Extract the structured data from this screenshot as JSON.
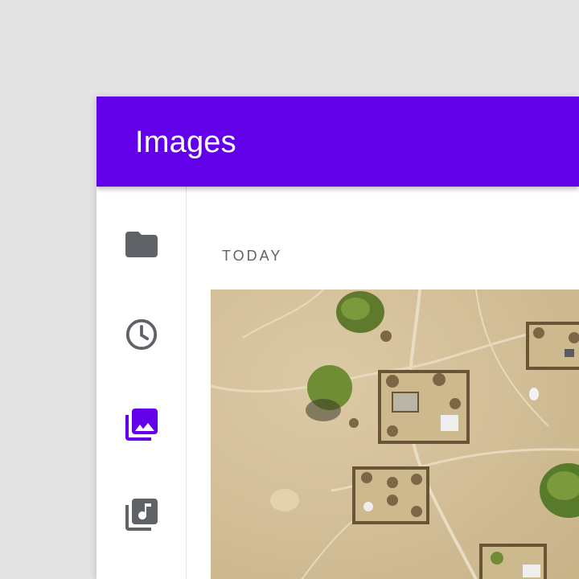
{
  "app": {
    "title": "Images"
  },
  "rail": {
    "items": [
      {
        "name": "folder",
        "icon": "folder-icon",
        "active": false
      },
      {
        "name": "recent",
        "icon": "clock-icon",
        "active": false
      },
      {
        "name": "images",
        "icon": "photo-library-icon",
        "active": true
      },
      {
        "name": "audio",
        "icon": "music-library-icon",
        "active": false
      }
    ]
  },
  "main": {
    "section_label": "TODAY"
  },
  "colors": {
    "primary": "#6200ea",
    "icon_inactive": "#5f6368",
    "background": "#e4e4e4"
  }
}
